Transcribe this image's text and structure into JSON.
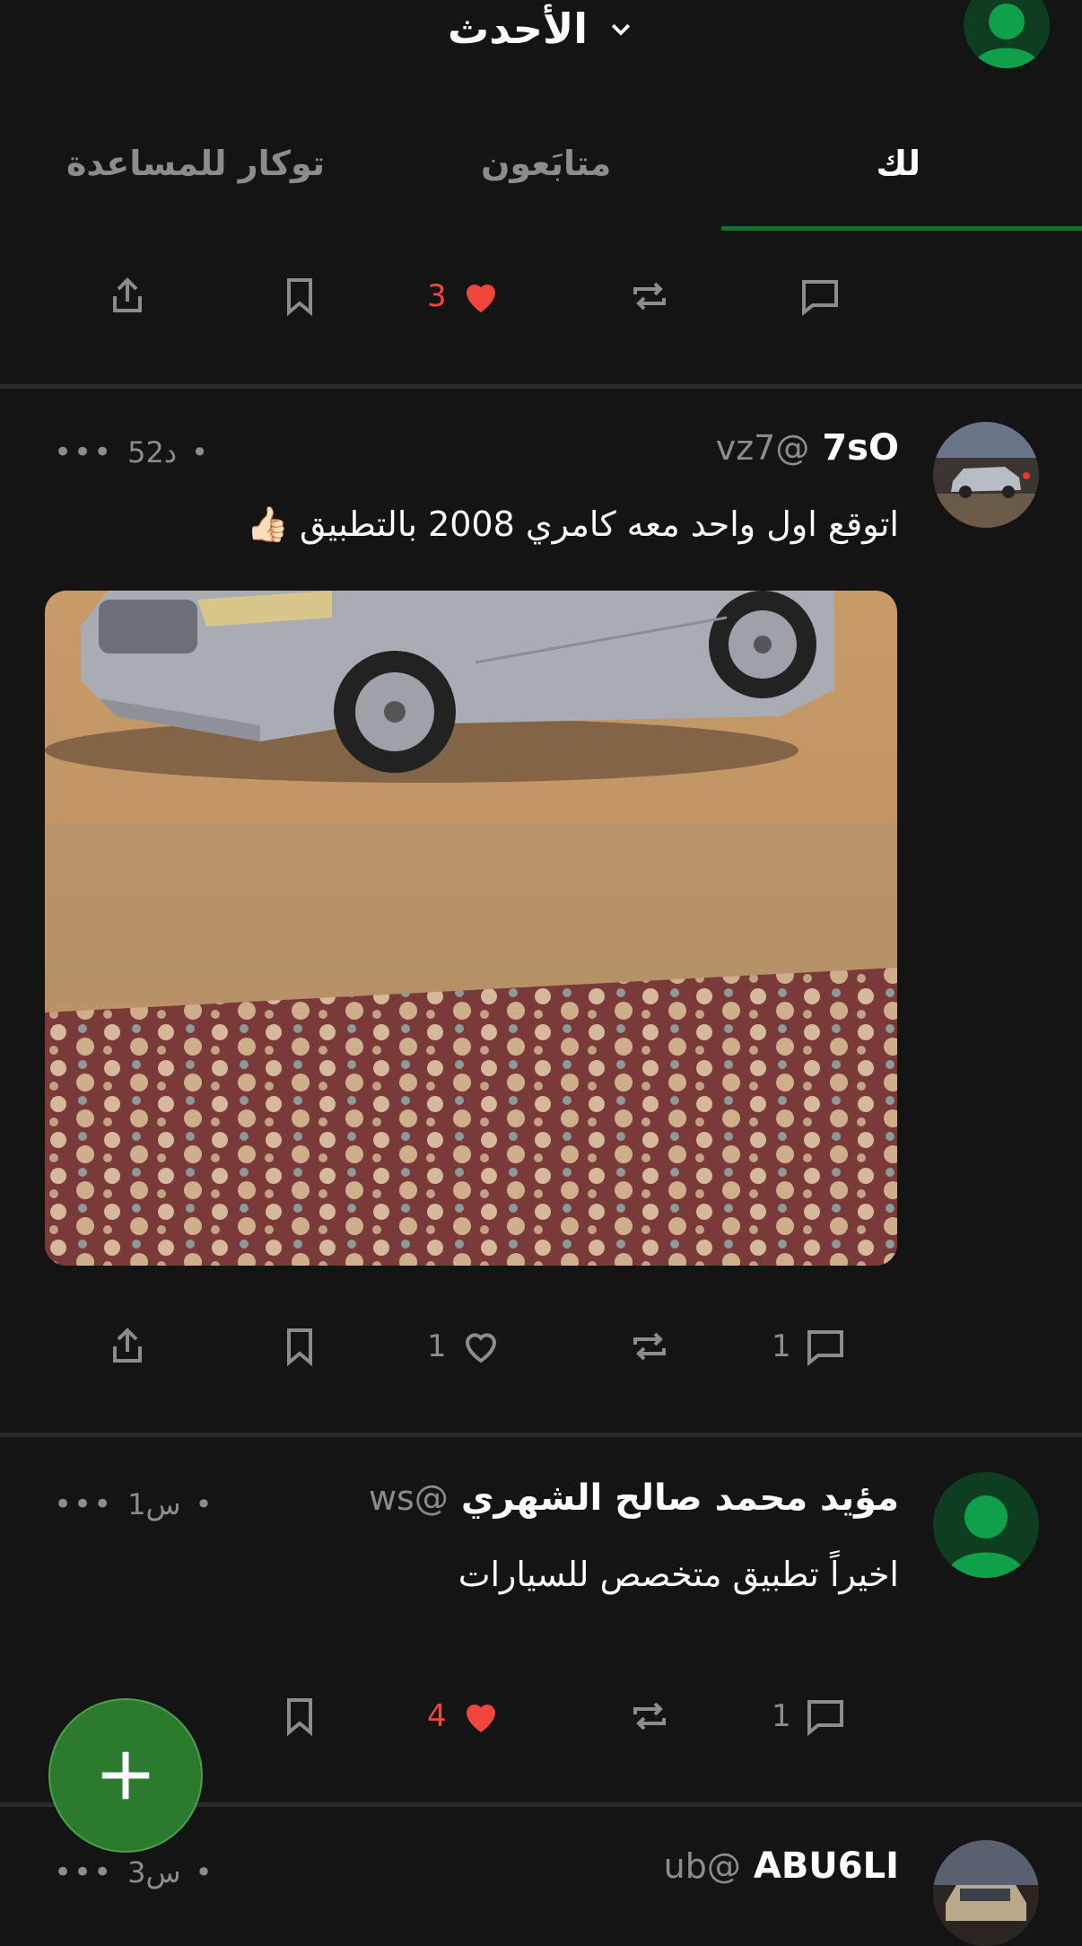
{
  "header": {
    "title": "الأحدث",
    "dropdown_icon": "chevron-down-icon"
  },
  "tabs": [
    {
      "label": "لك",
      "active": true
    },
    {
      "label": "متابَعون",
      "active": false
    },
    {
      "label": "توكار للمساعدة",
      "active": false
    }
  ],
  "colors": {
    "accent": "#1d6b2c",
    "like": "#f0463c",
    "fab": "#2b7a2d",
    "muted": "#8c8c8c"
  },
  "top_actions": {
    "likes": "3"
  },
  "posts": [
    {
      "name": "7sO",
      "handle": "vz7@",
      "time": "52د",
      "text": "اتوقع اول واحد معه كامري 2008 بالتطبيق 👍🏻",
      "comments": "1",
      "likes": "1"
    },
    {
      "name": "مؤيد محمد صالح الشهري",
      "handle": "ws@",
      "time": "1س",
      "text": "اخيراً تطبيق متخصص للسيارات",
      "comments": "1",
      "likes": "4"
    },
    {
      "name": "ABU6LI",
      "handle": "ub@",
      "time": "3س"
    }
  ]
}
